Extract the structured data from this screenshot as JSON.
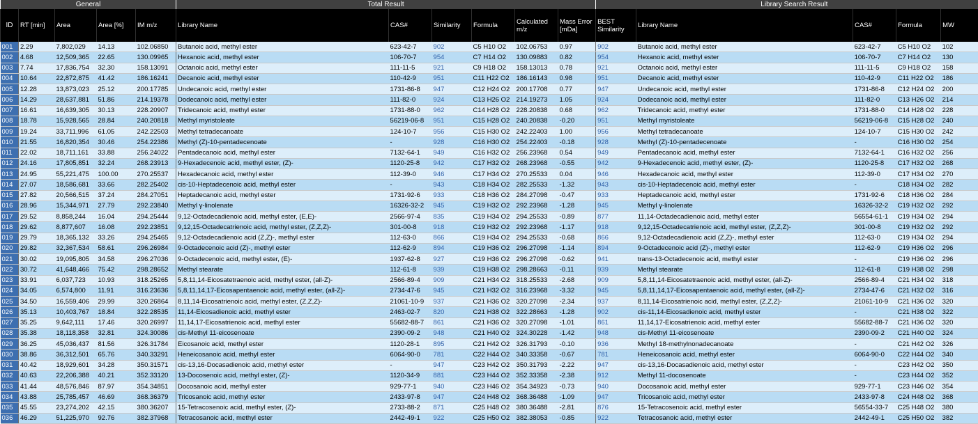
{
  "groups": {
    "general": "General",
    "total": "Total Result",
    "library": "Library Search Result"
  },
  "headers": {
    "id": "ID",
    "rt": "RT [min]",
    "area": "Area",
    "area_pct": "Area [%]",
    "im": "IM m/z",
    "lib_name": "Library Name",
    "cas": "CAS#",
    "similarity": "Similarity",
    "formula": "Formula",
    "calc": "Calculated m/z",
    "mass_err": "Mass Error [mDa]",
    "best_sim": "BEST Similarity",
    "lib_name2": "Library Name",
    "cas2": "CAS#",
    "formula2": "Formula",
    "mw": "MW"
  },
  "rows": [
    [
      "001",
      "2.29",
      "7,802,029",
      "14.13",
      "102.06850",
      "Butanoic acid, methyl ester",
      "623-42-7",
      "902",
      "C5 H10 O2",
      "102.06753",
      "0.97",
      "902",
      "Butanoic acid, methyl ester",
      "623-42-7",
      "C5 H10 O2",
      "102"
    ],
    [
      "002",
      "4.68",
      "12,509,365",
      "22.65",
      "130.09965",
      "Hexanoic acid, methyl ester",
      "106-70-7",
      "954",
      "C7 H14 O2",
      "130.09883",
      "0.82",
      "954",
      "Hexanoic acid, methyl ester",
      "106-70-7",
      "C7 H14 O2",
      "130"
    ],
    [
      "003",
      "7.74",
      "17,836,754",
      "32.30",
      "158.13091",
      "Octanoic acid, methyl ester",
      "111-11-5",
      "921",
      "C9 H18 O2",
      "158.13013",
      "0.78",
      "921",
      "Octanoic acid, methyl ester",
      "111-11-5",
      "C9 H18 O2",
      "158"
    ],
    [
      "004",
      "10.64",
      "22,872,875",
      "41.42",
      "186.16241",
      "Decanoic acid, methyl ester",
      "110-42-9",
      "951",
      "C11 H22 O2",
      "186.16143",
      "0.98",
      "951",
      "Decanoic acid, methyl ester",
      "110-42-9",
      "C11 H22 O2",
      "186"
    ],
    [
      "005",
      "12.28",
      "13,873,023",
      "25.12",
      "200.17785",
      "Undecanoic acid, methyl ester",
      "1731-86-8",
      "947",
      "C12 H24 O2",
      "200.17708",
      "0.77",
      "947",
      "Undecanoic acid, methyl ester",
      "1731-86-8",
      "C12 H24 O2",
      "200"
    ],
    [
      "006",
      "14.29",
      "28,637,881",
      "51.86",
      "214.19378",
      "Dodecanoic acid, methyl ester",
      "111-82-0",
      "924",
      "C13 H26 O2",
      "214.19273",
      "1.05",
      "924",
      "Dodecanoic acid, methyl ester",
      "111-82-0",
      "C13 H26 O2",
      "214"
    ],
    [
      "007",
      "16.61",
      "16,639,305",
      "30.13",
      "228.20907",
      "Tridecanoic acid, methyl ester",
      "1731-88-0",
      "962",
      "C14 H28 O2",
      "228.20838",
      "0.68",
      "962",
      "Tridecanoic acid, methyl ester",
      "1731-88-0",
      "C14 H28 O2",
      "228"
    ],
    [
      "008",
      "18.78",
      "15,928,565",
      "28.84",
      "240.20818",
      "Methyl myristoleate",
      "56219-06-8",
      "951",
      "C15 H28 O2",
      "240.20838",
      "-0.20",
      "951",
      "Methyl myristoleate",
      "56219-06-8",
      "C15 H28 O2",
      "240"
    ],
    [
      "009",
      "19.24",
      "33,711,996",
      "61.05",
      "242.22503",
      "Methyl tetradecanoate",
      "124-10-7",
      "956",
      "C15 H30 O2",
      "242.22403",
      "1.00",
      "956",
      "Methyl tetradecanoate",
      "124-10-7",
      "C15 H30 O2",
      "242"
    ],
    [
      "010",
      "21.55",
      "16,820,354",
      "30.46",
      "254.22386",
      "Methyl (Z)-10-pentadecenoate",
      "-",
      "928",
      "C16 H30 O2",
      "254.22403",
      "-0.18",
      "928",
      "Methyl (Z)-10-pentadecenoate",
      "-",
      "C16 H30 O2",
      "254"
    ],
    [
      "011",
      "22.02",
      "18,711,161",
      "33.88",
      "256.24022",
      "Pentadecanoic acid, methyl ester",
      "7132-64-1",
      "949",
      "C16 H32 O2",
      "256.23968",
      "0.54",
      "949",
      "Pentadecanoic acid, methyl ester",
      "7132-64-1",
      "C16 H32 O2",
      "256"
    ],
    [
      "012",
      "24.16",
      "17,805,851",
      "32.24",
      "268.23913",
      "9-Hexadecenoic acid, methyl ester, (Z)-",
      "1120-25-8",
      "942",
      "C17 H32 O2",
      "268.23968",
      "-0.55",
      "942",
      "9-Hexadecenoic acid, methyl ester, (Z)-",
      "1120-25-8",
      "C17 H32 O2",
      "268"
    ],
    [
      "013",
      "24.95",
      "55,221,475",
      "100.00",
      "270.25537",
      "Hexadecanoic acid, methyl ester",
      "112-39-0",
      "946",
      "C17 H34 O2",
      "270.25533",
      "0.04",
      "946",
      "Hexadecanoic acid, methyl ester",
      "112-39-0",
      "C17 H34 O2",
      "270"
    ],
    [
      "014",
      "27.07",
      "18,586,681",
      "33.66",
      "282.25402",
      "cis-10-Heptadecenoic acid, methyl ester",
      "-",
      "943",
      "C18 H34 O2",
      "282.25533",
      "-1.32",
      "943",
      "cis-10-Heptadecenoic acid, methyl ester",
      "-",
      "C18 H34 O2",
      "282"
    ],
    [
      "015",
      "27.82",
      "20,566,515",
      "37.24",
      "284.27051",
      "Heptadecanoic acid, methyl ester",
      "1731-92-6",
      "933",
      "C18 H36 O2",
      "284.27098",
      "-0.47",
      "933",
      "Heptadecanoic acid, methyl ester",
      "1731-92-6",
      "C18 H36 O2",
      "284"
    ],
    [
      "016",
      "28.96",
      "15,344,971",
      "27.79",
      "292.23840",
      "Methyl γ-linolenate",
      "16326-32-2",
      "945",
      "C19 H32 O2",
      "292.23968",
      "-1.28",
      "945",
      "Methyl γ-linolenate",
      "16326-32-2",
      "C19 H32 O2",
      "292"
    ],
    [
      "017",
      "29.52",
      "8,858,244",
      "16.04",
      "294.25444",
      "9,12-Octadecadienoic acid, methyl ester, (E,E)-",
      "2566-97-4",
      "835",
      "C19 H34 O2",
      "294.25533",
      "-0.89",
      "877",
      "11,14-Octadecadienoic acid, methyl ester",
      "56554-61-1",
      "C19 H34 O2",
      "294"
    ],
    [
      "018",
      "29.62",
      "8,877,607",
      "16.08",
      "292.23851",
      "9,12,15-Octadecatrienoic acid, methyl ester, (Z,Z,Z)-",
      "301-00-8",
      "918",
      "C19 H32 O2",
      "292.23968",
      "-1.17",
      "918",
      "9,12,15-Octadecatrienoic acid, methyl ester, (Z,Z,Z)-",
      "301-00-8",
      "C19 H32 O2",
      "292"
    ],
    [
      "019",
      "29.79",
      "18,365,132",
      "33.26",
      "294.25465",
      "9,12-Octadecadienoic acid (Z,Z)-, methyl ester",
      "112-63-0",
      "866",
      "C19 H34 O2",
      "294.25533",
      "-0.68",
      "866",
      "9,12-Octadecadienoic acid (Z,Z)-, methyl ester",
      "112-63-0",
      "C19 H34 O2",
      "294"
    ],
    [
      "020",
      "29.82",
      "32,367,534",
      "58.61",
      "296.26984",
      "9-Octadecenoic acid (Z)-, methyl ester",
      "112-62-9",
      "894",
      "C19 H36 O2",
      "296.27098",
      "-1.14",
      "894",
      "9-Octadecenoic acid (Z)-, methyl ester",
      "112-62-9",
      "C19 H36 O2",
      "296"
    ],
    [
      "021",
      "30.02",
      "19,095,805",
      "34.58",
      "296.27036",
      "9-Octadecenoic acid, methyl ester, (E)-",
      "1937-62-8",
      "927",
      "C19 H36 O2",
      "296.27098",
      "-0.62",
      "941",
      "trans-13-Octadecenoic acid, methyl ester",
      "-",
      "C19 H36 O2",
      "296"
    ],
    [
      "022",
      "30.72",
      "41,648,466",
      "75.42",
      "298.28652",
      "Methyl stearate",
      "112-61-8",
      "939",
      "C19 H38 O2",
      "298.28663",
      "-0.11",
      "939",
      "Methyl stearate",
      "112-61-8",
      "C19 H38 O2",
      "298"
    ],
    [
      "023",
      "33.91",
      "6,037,723",
      "10.93",
      "318.25265",
      "5,8,11,14-Eicosatetraenoic acid, methyl ester, (all-Z)-",
      "2566-89-4",
      "909",
      "C21 H34 O2",
      "318.25533",
      "-2.68",
      "909",
      "5,8,11,14-Eicosatetraenoic acid, methyl ester, (all-Z)-",
      "2566-89-4",
      "C21 H34 O2",
      "318"
    ],
    [
      "024",
      "34.05",
      "6,574,800",
      "11.91",
      "316.23636",
      "5,8,11,14,17-Eicosapentaenoic acid, methyl ester, (all-Z)-",
      "2734-47-6",
      "945",
      "C21 H32 O2",
      "316.23968",
      "-3.32",
      "945",
      "5,8,11,14,17-Eicosapentaenoic acid, methyl ester, (all-Z)-",
      "2734-47-6",
      "C21 H32 O2",
      "316"
    ],
    [
      "025",
      "34.50",
      "16,559,406",
      "29.99",
      "320.26864",
      "8,11,14-Eicosatrienoic acid, methyl ester, (Z,Z,Z)-",
      "21061-10-9",
      "937",
      "C21 H36 O2",
      "320.27098",
      "-2.34",
      "937",
      "8,11,14-Eicosatrienoic acid, methyl ester, (Z,Z,Z)-",
      "21061-10-9",
      "C21 H36 O2",
      "320"
    ],
    [
      "026",
      "35.13",
      "10,403,767",
      "18.84",
      "322.28535",
      "11,14-Eicosadienoic acid, methyl ester",
      "2463-02-7",
      "820",
      "C21 H38 O2",
      "322.28663",
      "-1.28",
      "902",
      "cis-11,14-Eicosadienoic acid, methyl ester",
      "-",
      "C21 H38 O2",
      "322"
    ],
    [
      "027",
      "35.25",
      "9,642,111",
      "17.46",
      "320.26997",
      "11,14,17-Eicosatrienoic acid, methyl ester",
      "55682-88-7",
      "861",
      "C21 H36 O2",
      "320.27098",
      "-1.01",
      "861",
      "11,14,17-Eicosatrienoic acid, methyl ester",
      "55682-88-7",
      "C21 H36 O2",
      "320"
    ],
    [
      "028",
      "35.38",
      "18,118,358",
      "32.81",
      "324.30086",
      "cis-Methyl 11-eicosenoate",
      "2390-09-2",
      "948",
      "C21 H40 O2",
      "324.30228",
      "-1.42",
      "948",
      "cis-Methyl 11-eicosenoate",
      "2390-09-2",
      "C21 H40 O2",
      "324"
    ],
    [
      "029",
      "36.25",
      "45,036,437",
      "81.56",
      "326.31784",
      "Eicosanoic acid, methyl ester",
      "1120-28-1",
      "895",
      "C21 H42 O2",
      "326.31793",
      "-0.10",
      "936",
      "Methyl 18-methylnonadecanoate",
      "-",
      "C21 H42 O2",
      "326"
    ],
    [
      "030",
      "38.86",
      "36,312,501",
      "65.76",
      "340.33291",
      "Heneicosanoic acid, methyl ester",
      "6064-90-0",
      "781",
      "C22 H44 O2",
      "340.33358",
      "-0.67",
      "781",
      "Heneicosanoic acid, methyl ester",
      "6064-90-0",
      "C22 H44 O2",
      "340"
    ],
    [
      "031",
      "40.42",
      "18,929,601",
      "34.28",
      "350.31571",
      "cis-13,16-Docasadienoic acid, methyl ester",
      "-",
      "947",
      "C23 H42 O2",
      "350.31793",
      "-2.22",
      "947",
      "cis-13,16-Docasadienoic acid, methyl ester",
      "-",
      "C23 H42 O2",
      "350"
    ],
    [
      "032",
      "40.63",
      "22,206,388",
      "40.21",
      "352.33120",
      "13-Docosenoic acid, methyl ester, (Z)-",
      "1120-34-9",
      "881",
      "C23 H44 O2",
      "352.33358",
      "-2.38",
      "912",
      "Methyl 11-docosenoate",
      "-",
      "C23 H44 O2",
      "352"
    ],
    [
      "033",
      "41.44",
      "48,576,846",
      "87.97",
      "354.34851",
      "Docosanoic acid, methyl ester",
      "929-77-1",
      "940",
      "C23 H46 O2",
      "354.34923",
      "-0.73",
      "940",
      "Docosanoic acid, methyl ester",
      "929-77-1",
      "C23 H46 O2",
      "354"
    ],
    [
      "034",
      "43.88",
      "25,785,457",
      "46.69",
      "368.36379",
      "Tricosanoic acid, methyl ester",
      "2433-97-8",
      "947",
      "C24 H48 O2",
      "368.36488",
      "-1.09",
      "947",
      "Tricosanoic acid, methyl ester",
      "2433-97-8",
      "C24 H48 O2",
      "368"
    ],
    [
      "035",
      "45.55",
      "23,274,202",
      "42.15",
      "380.36207",
      "15-Tetracosenoic acid, methyl ester, (Z)-",
      "2733-88-2",
      "871",
      "C25 H48 O2",
      "380.36488",
      "-2.81",
      "876",
      "15-Tetracosenoic acid, methyl ester",
      "56554-33-7",
      "C25 H48 O2",
      "380"
    ],
    [
      "036",
      "46.29",
      "51,225,970",
      "92.76",
      "382.37968",
      "Tetracosanoic acid, methyl ester",
      "2442-49-1",
      "922",
      "C25 H50 O2",
      "382.38053",
      "-0.85",
      "922",
      "Tetracosanoic acid, methyl ester",
      "2442-49-1",
      "C25 H50 O2",
      "382"
    ]
  ]
}
